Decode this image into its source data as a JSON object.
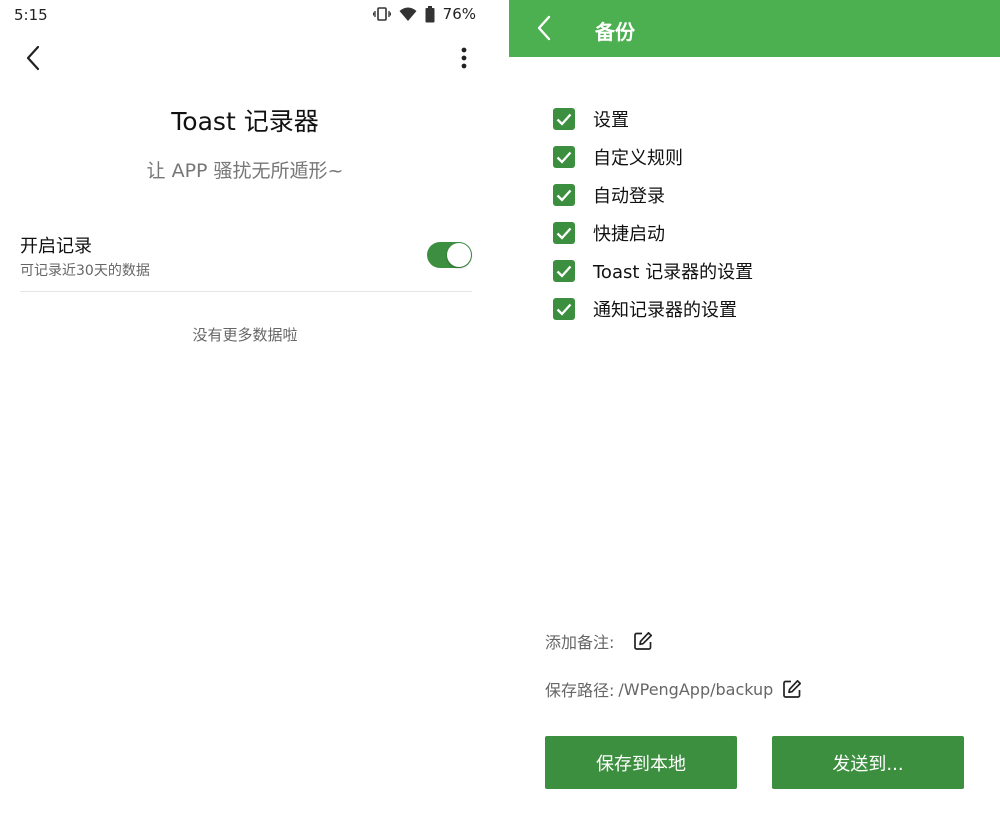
{
  "left": {
    "status": {
      "time": "5:15",
      "battery": "76%"
    },
    "title": "Toast 记录器",
    "subtitle": "让 APP 骚扰无所遁形~",
    "setting": {
      "title": "开启记录",
      "desc": "可记录近30天的数据",
      "enabled": true
    },
    "empty_text": "没有更多数据啦"
  },
  "right": {
    "app_bar_title": "备份",
    "items": [
      {
        "label": "设置",
        "checked": true
      },
      {
        "label": "自定义规则",
        "checked": true
      },
      {
        "label": "自动登录",
        "checked": true
      },
      {
        "label": "快捷启动",
        "checked": true
      },
      {
        "label": "Toast 记录器的设置",
        "checked": true
      },
      {
        "label": "通知记录器的设置",
        "checked": true
      }
    ],
    "note_label": "添加备注:",
    "path_label": "保存路径:",
    "path_value": "/WPengApp/backup",
    "save_button": "保存到本地",
    "send_button": "发送到..."
  },
  "colors": {
    "accent": "#4caf50",
    "primary_dark": "#3c8f3f"
  }
}
